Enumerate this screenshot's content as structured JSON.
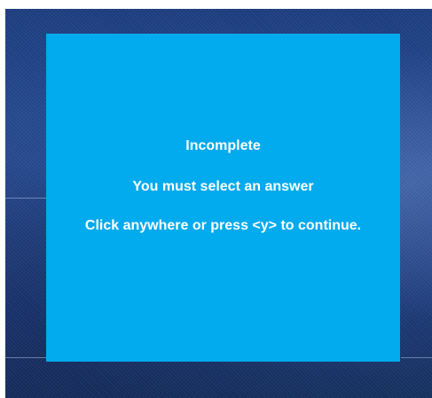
{
  "dialog": {
    "title": "Incomplete",
    "message": "You must select an answer",
    "hint": "Click anywhere or press <y> to continue.",
    "background_color": "#02aaee",
    "text_color": "#ffffff"
  },
  "backdrop": {
    "color": "#1d3e80"
  }
}
